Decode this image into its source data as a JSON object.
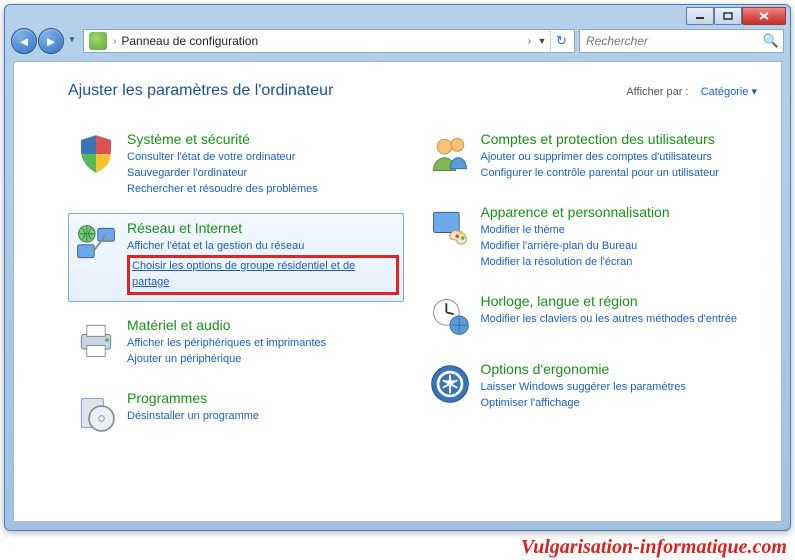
{
  "breadcrumb": {
    "root_icon": "control-panel",
    "path": "Panneau de configuration",
    "sep": "›"
  },
  "search": {
    "placeholder": "Rechercher"
  },
  "page_title": "Ajuster les paramètres de l'ordinateur",
  "view_by": {
    "label": "Afficher par :",
    "value": "Catégorie ▾"
  },
  "left_col": [
    {
      "id": "system",
      "icon": "shield-icon",
      "title": "Système et sécurité",
      "links": [
        "Consulter l'état de votre ordinateur",
        "Sauvegarder l'ordinateur",
        "Rechercher et résoudre des problèmes"
      ]
    },
    {
      "id": "network",
      "icon": "globe-network-icon",
      "title": "Réseau et Internet",
      "highlighted": true,
      "links": [
        "Afficher l'état et la gestion du réseau",
        "Choisir les options de groupe résidentiel et de partage"
      ],
      "emphasized_link_index": 1
    },
    {
      "id": "hardware",
      "icon": "printer-icon",
      "title": "Matériel et audio",
      "links": [
        "Afficher les périphériques et imprimantes",
        "Ajouter un périphérique"
      ]
    },
    {
      "id": "programs",
      "icon": "cd-box-icon",
      "title": "Programmes",
      "links": [
        "Désinstaller un programme"
      ]
    }
  ],
  "right_col": [
    {
      "id": "users",
      "icon": "people-icon",
      "title": "Comptes et protection des utilisateurs",
      "links": [
        "Ajouter ou supprimer des comptes d'utilisateurs",
        "Configurer le contrôle parental pour un utilisateur"
      ]
    },
    {
      "id": "appearance",
      "icon": "palette-icon",
      "title": "Apparence et personnalisation",
      "links": [
        "Modifier le thème",
        "Modifier l'arrière-plan du Bureau",
        "Modifier la résolution de l'écran"
      ]
    },
    {
      "id": "clock",
      "icon": "clock-globe-icon",
      "title": "Horloge, langue et région",
      "links": [
        "Modifier les claviers ou les autres méthodes d'entrée"
      ]
    },
    {
      "id": "ease",
      "icon": "ease-access-icon",
      "title": "Options d'ergonomie",
      "links": [
        "Laisser Windows suggérer les paramètres",
        "Optimiser l'affichage"
      ]
    }
  ],
  "watermark": "Vulgarisation-informatique.com"
}
